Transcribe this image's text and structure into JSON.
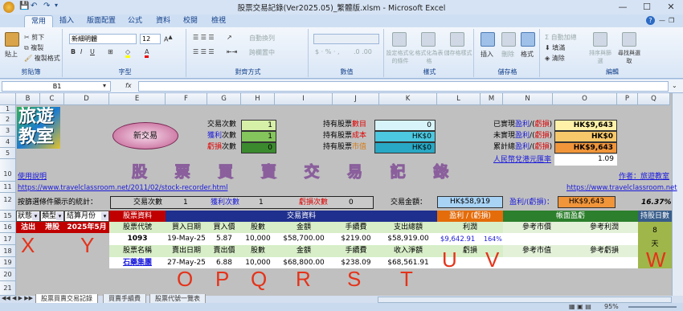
{
  "window": {
    "title": "股票交易記錄(Ver2025.05)_繁體版.xlsm - Microsoft Excel"
  },
  "ribbon": {
    "tabs": [
      "常用",
      "插入",
      "版面配置",
      "公式",
      "資料",
      "校閱",
      "檢視"
    ],
    "clipboard": {
      "paste": "貼上",
      "cut": "剪下",
      "copy": "複製",
      "format_painter": "複製格式",
      "label": "剪貼簿"
    },
    "font": {
      "name": "新細明體",
      "size": "12",
      "label": "字型"
    },
    "alignment": {
      "wrap": "自動換列",
      "merge": "跨欄置中",
      "label": "對齊方式"
    },
    "number": {
      "label": "數值"
    },
    "styles": {
      "conditional": "設定格式化的條件",
      "table": "格式化為表格",
      "cell": "儲存格樣式",
      "label": "樣式"
    },
    "cells": {
      "insert": "插入",
      "delete": "刪除",
      "format": "格式",
      "label": "儲存格"
    },
    "editing": {
      "autosum": "自動加總",
      "fill": "填滿",
      "clear": "清除",
      "sort": "排序與篩選",
      "find": "尋找與選取",
      "label": "編輯"
    }
  },
  "formula_bar": {
    "name_box": "B1",
    "fx": "fx"
  },
  "columns": [
    "B",
    "C",
    "D",
    "E",
    "F",
    "G",
    "H",
    "I",
    "J",
    "K",
    "L",
    "M",
    "N",
    "O",
    "P",
    "Q"
  ],
  "rows": [
    "1",
    "2",
    "3",
    "4",
    "5",
    "10",
    "11",
    "12",
    "15",
    "16",
    "17",
    "18",
    "19",
    "20",
    "21"
  ],
  "sheet": {
    "logo": [
      "旅遊",
      "教室"
    ],
    "new_trade": "新交易",
    "counts": [
      {
        "label": "交易次數",
        "value": "1"
      },
      {
        "label": "獲利次數",
        "value": "1"
      },
      {
        "label": "虧損次數",
        "value": "0"
      }
    ],
    "holdings": [
      {
        "label": "持有股票數目",
        "value": "0"
      },
      {
        "label": "持有股票成本",
        "value": "HK$0"
      },
      {
        "label": "持有股票市值",
        "value": "HK$0"
      }
    ],
    "pl": [
      {
        "label": "已實現盈利/(虧損)",
        "value": "HK$9,643"
      },
      {
        "label": "未實現盈利/(虧損)",
        "value": "HK$0"
      },
      {
        "label": "累計總盈利/(虧損)",
        "value": "HK$9,643"
      }
    ],
    "fx_label": "人民幣兌港元匯率",
    "fx_value": "1.09",
    "banner": "股 票 買 賣 交 易 記 錄",
    "help": "使用說明",
    "author": "作者：旅遊教室",
    "link1": "https://www.travelclassroom.net/2011/02/stock-recorder.html",
    "link2": "https://www.travelclassroom.net",
    "stats_label": "按篩選條件顯示的統計：",
    "stats": [
      {
        "label": "交易次數",
        "value": "1"
      },
      {
        "label": "獲利次數",
        "value": "1"
      },
      {
        "label": "虧損次數",
        "value": "0"
      }
    ],
    "amount_label": "交易金額：",
    "amount_value": "HK$58,919",
    "profit_label": "盈利/(虧損)：",
    "profit_value": "HK$9,643",
    "profit_pct": "16.37%",
    "filters": [
      "狀態",
      "類型",
      "結算月份"
    ],
    "filter_values": [
      "沽出",
      "港股",
      "2025年5月"
    ],
    "sec_stock": "股票資料",
    "sec_trade": "交易資料",
    "sec_pl": "盈利 / (虧損)",
    "sec_book": "帳面盈虧",
    "sec_days": "持股日數",
    "hdr1": [
      "股票代號",
      "買入日期",
      "買入價",
      "股數",
      "金額",
      "手續費",
      "支出總額",
      "利潤",
      "參考市價",
      "參考利潤"
    ],
    "hdr2": [
      "股票名稱",
      "賣出日期",
      "賣出價",
      "股數",
      "金額",
      "手續費",
      "收入淨額",
      "虧損",
      "參考市值",
      "參考虧損"
    ],
    "r1": [
      "1093",
      "19-May-25",
      "5.87",
      "10,000",
      "$58,700.00",
      "$219.00",
      "$58,919.00",
      "$9,642.91",
      "164%"
    ],
    "r2": [
      "石藥集團",
      "27-May-25",
      "6.88",
      "10,000",
      "$68,800.00",
      "$238.09",
      "$68,561.91"
    ],
    "days": [
      "8",
      "天"
    ]
  },
  "overlay_letters": [
    "X",
    "Y",
    "O",
    "P",
    "Q",
    "R",
    "S",
    "T",
    "U",
    "V",
    "W"
  ],
  "sheet_tabs": [
    "股票買賣交易記錄",
    "買賣手續費",
    "股票代號一覽表"
  ],
  "status": {
    "zoom": "95%"
  }
}
